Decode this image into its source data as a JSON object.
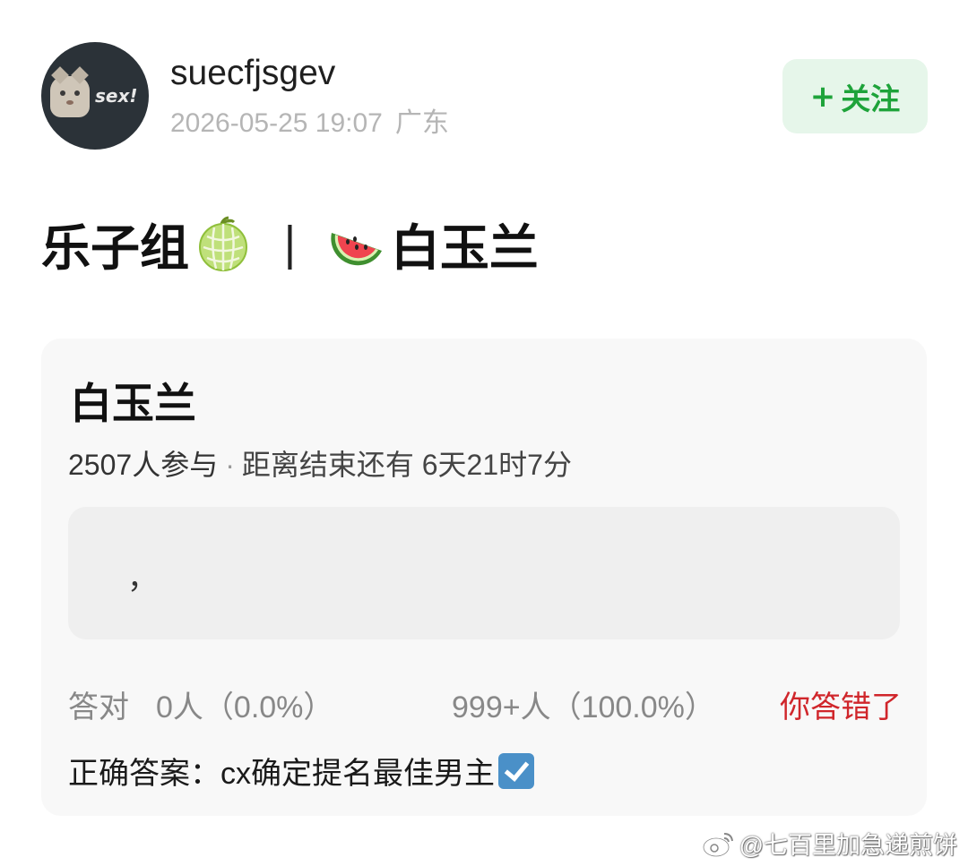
{
  "header": {
    "username": "suecfjsgev",
    "avatar_text": "sex!",
    "timestamp": "2026-05-25 19:07",
    "region": "广东",
    "follow_label": "关注",
    "follow_icon": "plus-icon"
  },
  "post": {
    "title_left": "乐子组",
    "title_sep": "|",
    "title_right": "白玉兰",
    "icons": [
      "melon-emoji",
      "watermelon-emoji"
    ]
  },
  "poll": {
    "title": "白玉兰",
    "participants": "2507人参与",
    "remaining": "距离结束还有 6天21时7分",
    "option_text": "，",
    "correct_label": "答对",
    "correct_count": "0人（0.0%）",
    "wrong_count": "999+人（100.0%）",
    "wrong_tag": "你答错了",
    "answer_prefix": "正确答案：",
    "answer_text": "cx确定提名最佳男主",
    "answer_icon": "check-box-icon"
  },
  "watermark": {
    "text": "@七百里加急递煎饼",
    "icon": "weibo-icon"
  },
  "colors": {
    "follow_bg": "#e6f6ea",
    "follow_text": "#1ea33a",
    "wrong_tag": "#d0262b",
    "card_bg": "#f8f8f8",
    "meta_text": "#b5b5b5"
  }
}
